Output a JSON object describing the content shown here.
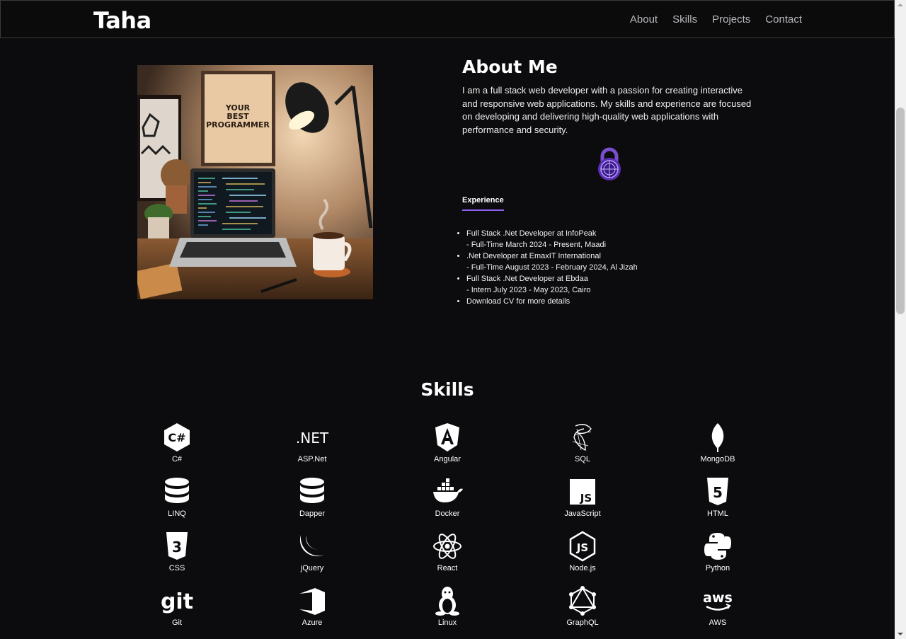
{
  "brand": "Taha",
  "nav": [
    "About",
    "Skills",
    "Projects",
    "Contact"
  ],
  "about": {
    "title": "About Me",
    "text": "I am a full stack web developer with a passion for creating interactive and responsive web applications. My skills and experience are focused on developing and delivering high-quality web applications with performance and security.",
    "tab": "Experience",
    "experience": [
      {
        "role": "Full Stack .Net Developer at InfoPeak",
        "detail": "- Full-Time March 2024 - Present, Maadi"
      },
      {
        "role": ".Net Developer at EmaxIT International",
        "detail": "- Full-Time August 2023 - February 2024, Al Jizah"
      },
      {
        "role": "Full Stack .Net Developer at Ebdaa",
        "detail": "- Intern July 2023 - May 2023, Cairo"
      },
      {
        "role": "Download CV for more details",
        "detail": ""
      }
    ]
  },
  "photo": {
    "poster_text": "YOUR BEST PROGRAMMER"
  },
  "skills": {
    "title": "Skills",
    "items": [
      {
        "label": "C#",
        "icon": "csharp-icon"
      },
      {
        "label": "ASP.Net",
        "icon": "dotnet-icon"
      },
      {
        "label": "Angular",
        "icon": "angular-icon"
      },
      {
        "label": "SQL",
        "icon": "sql-server-icon"
      },
      {
        "label": "MongoDB",
        "icon": "mongodb-icon"
      },
      {
        "label": "LINQ",
        "icon": "database-icon"
      },
      {
        "label": "Dapper",
        "icon": "database-icon"
      },
      {
        "label": "Docker",
        "icon": "docker-icon"
      },
      {
        "label": "JavaScript",
        "icon": "javascript-icon"
      },
      {
        "label": "HTML",
        "icon": "html5-icon"
      },
      {
        "label": "CSS",
        "icon": "css3-icon"
      },
      {
        "label": "jQuery",
        "icon": "jquery-icon"
      },
      {
        "label": "React",
        "icon": "react-icon"
      },
      {
        "label": "Node.js",
        "icon": "nodejs-icon"
      },
      {
        "label": "Python",
        "icon": "python-icon"
      },
      {
        "label": "Git",
        "icon": "git-icon"
      },
      {
        "label": "Azure",
        "icon": "azure-icon"
      },
      {
        "label": "Linux",
        "icon": "linux-icon"
      },
      {
        "label": "GraphQL",
        "icon": "graphql-icon"
      },
      {
        "label": "AWS",
        "icon": "aws-icon"
      }
    ]
  },
  "colors": {
    "background": "#0c0b0d",
    "accent": "#8f5ef2",
    "nav_text": "#b9b9bd"
  }
}
